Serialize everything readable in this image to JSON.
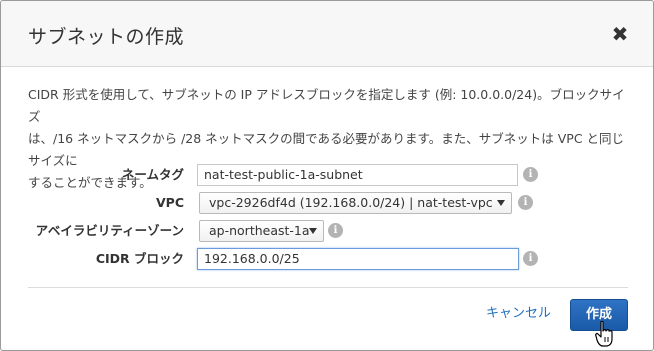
{
  "dialog": {
    "title": "サブネットの作成",
    "close_glyph": "✖",
    "description_lines": [
      "CIDR 形式を使用して、サブネットの IP アドレスブロックを指定します (例: 10.0.0.0/24)。ブロックサイズ",
      "は、/16 ネットマスクから /28 ネットマスクの間である必要があります。また、サブネットは VPC と同じサイズに",
      "することができます。"
    ]
  },
  "form": {
    "name_tag": {
      "label": "ネームタグ",
      "value": "nat-test-public-1a-subnet"
    },
    "vpc": {
      "label": "VPC",
      "value": "vpc-2926df4d (192.168.0.0/24) | nat-test-vpc"
    },
    "az": {
      "label": "アベイラビリティーゾーン",
      "value": "ap-northeast-1a"
    },
    "cidr": {
      "label": "CIDR ブロック",
      "value": "192.168.0.0/25"
    },
    "info_glyph": "i"
  },
  "footer": {
    "cancel_label": "キャンセル",
    "create_label": "作成"
  },
  "colors": {
    "primary_button": "#1f64b4",
    "link": "#1f6fbf",
    "focus_border": "#6b9bd8"
  },
  "icons": [
    "close-icon",
    "info-icon",
    "chevron-down-icon",
    "hand-pointer-icon"
  ]
}
